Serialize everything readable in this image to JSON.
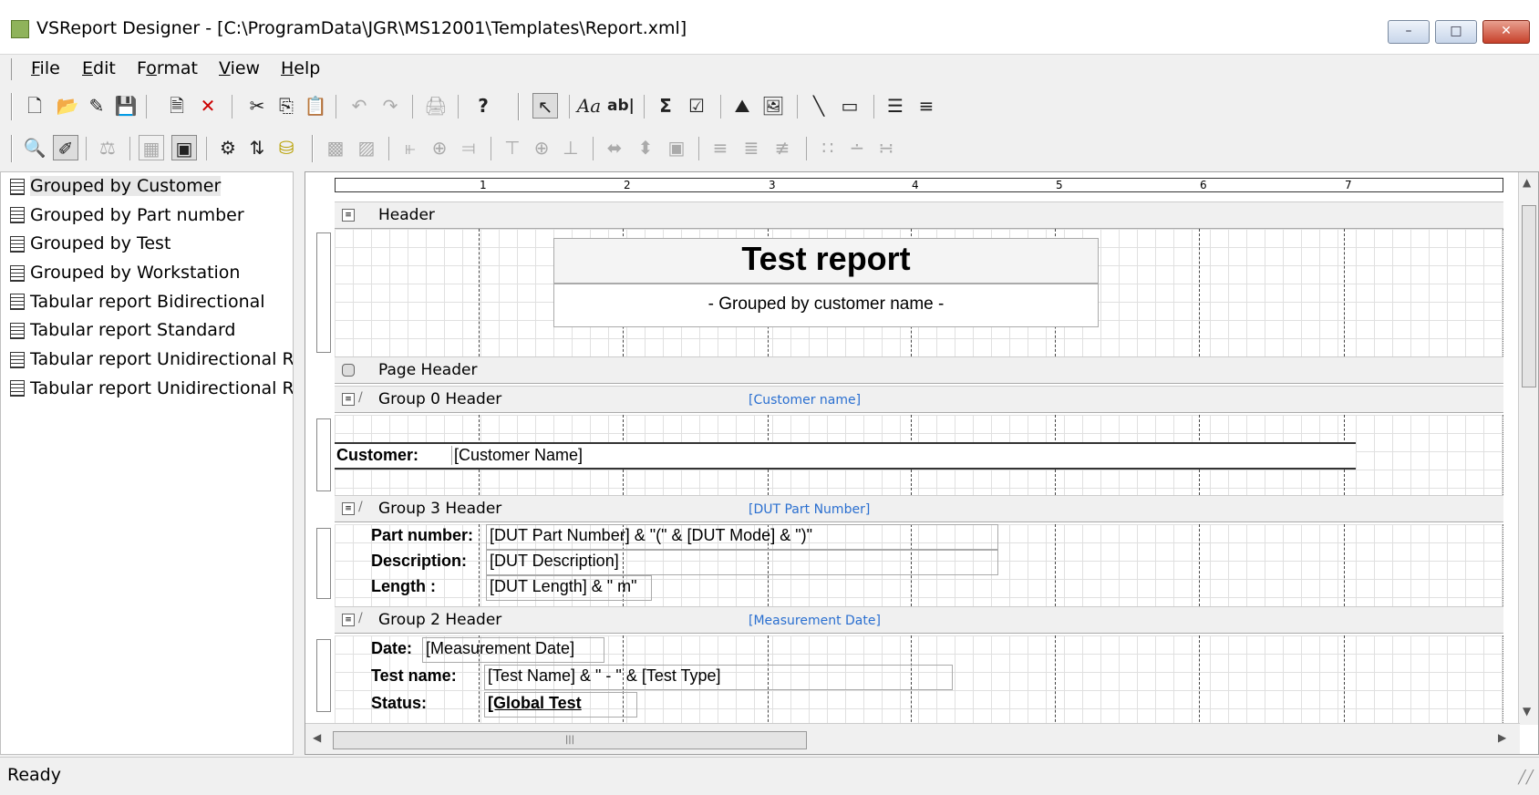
{
  "window": {
    "title": "VSReport Designer - [C:\\ProgramData\\JGR\\MS12001\\Templates\\Report.xml]",
    "controls": {
      "minimize": "–",
      "maximize": "□",
      "close": "✕"
    }
  },
  "menu": {
    "items": [
      {
        "key": "F",
        "rest": "ile"
      },
      {
        "key": "E",
        "rest": "dit"
      },
      {
        "pre": "F",
        "key": "o",
        "rest": "rmat"
      },
      {
        "key": "V",
        "rest": "iew"
      },
      {
        "key": "H",
        "rest": "elp"
      }
    ]
  },
  "toolbar1": {
    "icons": [
      "new-icon",
      "open-icon",
      "wizard-icon",
      "save-icon",
      "new-report-icon",
      "delete-icon",
      "cut-icon",
      "copy-icon",
      "paste-icon",
      "undo-icon",
      "redo-icon",
      "print-icon",
      "help-icon",
      "pointer-icon",
      "label-icon",
      "textbox-icon",
      "sum-icon",
      "checkbox-icon",
      "chart-icon",
      "image-icon",
      "line-icon",
      "rectangle-icon",
      "subreport-icon",
      "pagebreak-icon"
    ],
    "glyphs": [
      "🗋",
      "📂",
      "✎",
      "💾",
      "🗎",
      "✕",
      "✂",
      "⎘",
      "📋",
      "↶",
      "↷",
      "🖨",
      "?",
      "↖",
      "Aa",
      "ab|",
      "Σ",
      "☑",
      "⛰",
      "🖼",
      "╲",
      "▭",
      "☰",
      "≡"
    ],
    "label_text": "Aa",
    "textbox_text": "ab|",
    "sum_text": "Σ",
    "help_text": "?"
  },
  "toolbar2": {
    "icons": [
      "preview-icon",
      "design-icon",
      "fields-icon",
      "grid-icon",
      "snap-icon",
      "properties-icon",
      "sorting-icon",
      "datasource-icon",
      "bring-front-icon",
      "send-back-icon",
      "align-left-icon",
      "align-center-icon",
      "align-right-icon",
      "align-top-icon",
      "align-middle-icon",
      "align-bottom-icon",
      "same-width-icon",
      "same-height-icon",
      "same-size-icon",
      "hspace-equal-icon",
      "hspace-inc-icon",
      "hspace-dec-icon",
      "vspace-equal-icon",
      "vspace-inc-icon",
      "vspace-dec-icon"
    ]
  },
  "sidebar": {
    "items": [
      {
        "label": "Grouped  by Customer",
        "selected": true
      },
      {
        "label": "Grouped  by Part number",
        "selected": false
      },
      {
        "label": "Grouped  by Test",
        "selected": false
      },
      {
        "label": "Grouped  by Workstation",
        "selected": false
      },
      {
        "label": "Tabular report Bidirectional",
        "selected": false
      },
      {
        "label": "Tabular report Standard",
        "selected": false
      },
      {
        "label": "Tabular report Unidirectional RI",
        "selected": false
      },
      {
        "label": "Tabular report Unidirectional RI",
        "selected": false
      }
    ]
  },
  "ruler": {
    "marks": [
      "1",
      "2",
      "3",
      "4",
      "5",
      "6",
      "7"
    ]
  },
  "bands": {
    "header": {
      "label": "Header"
    },
    "page_header": {
      "label": "Page Header"
    },
    "group0": {
      "label": "Group 0 Header",
      "field": "[Customer name]"
    },
    "group3": {
      "label": "Group 3 Header",
      "field": "[DUT Part Number]"
    },
    "group2": {
      "label": "Group 2 Header",
      "field": "[Measurement Date]"
    }
  },
  "report": {
    "title": "Test report",
    "subtitle": "- Grouped by customer name -",
    "customer_label": "Customer:",
    "customer_value": "[Customer Name]",
    "part_number_label": "Part number:",
    "part_number_value": "[DUT Part Number] & \"(\" & [DUT Mode] & \")\"",
    "description_label": "Description:",
    "description_value": "[DUT Description]",
    "length_label": "Length :",
    "length_value": "[DUT Length] & \" m\"",
    "date_label": "Date:",
    "date_value": "[Measurement Date]",
    "test_name_label": "Test name:",
    "test_name_value": "[Test Name] & \" - \"  & [Test Type]",
    "status_label": "Status:",
    "status_value": "[Global Test"
  },
  "statusbar": {
    "text": "Ready"
  }
}
